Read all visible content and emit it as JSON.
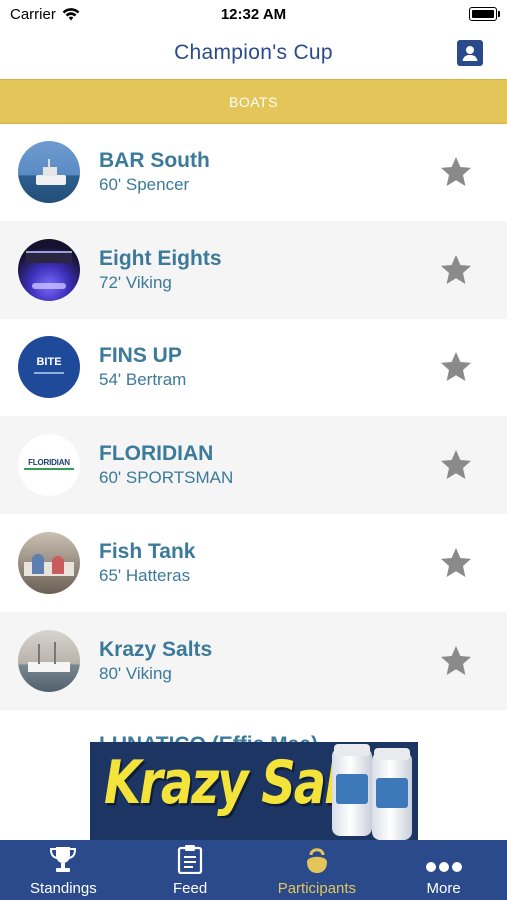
{
  "status_bar": {
    "carrier": "Carrier",
    "time": "12:32 AM"
  },
  "nav": {
    "title": "Champion's Cup"
  },
  "section": {
    "label": "BOATS"
  },
  "boats": [
    {
      "name": "BAR South",
      "model": "60' Spencer"
    },
    {
      "name": "Eight Eights",
      "model": "72' Viking"
    },
    {
      "name": "FINS UP",
      "model": "54' Bertram"
    },
    {
      "name": "FLORIDIAN",
      "model": "60' SPORTSMAN"
    },
    {
      "name": "Fish Tank",
      "model": "65' Hatteras"
    },
    {
      "name": "Krazy Salts",
      "model": "80' Viking"
    }
  ],
  "partial_row": {
    "name": "LUNATICO (Effie Mae)"
  },
  "avatar_texts": {
    "fins_up": "BITE",
    "floridian": "FLORIDIAN"
  },
  "ad": {
    "text": "Krazy Salt's"
  },
  "tabs": [
    {
      "label": "Standings",
      "icon": "trophy-icon"
    },
    {
      "label": "Feed",
      "icon": "clipboard-icon"
    },
    {
      "label": "Participants",
      "icon": "kettlebell-icon",
      "active": true
    },
    {
      "label": "More",
      "icon": "more-dots-icon"
    }
  ],
  "colors": {
    "primary": "#2a4a8c",
    "accent": "#e3c55a",
    "boat_text": "#3b7a9a",
    "star": "#8a8a8a"
  }
}
